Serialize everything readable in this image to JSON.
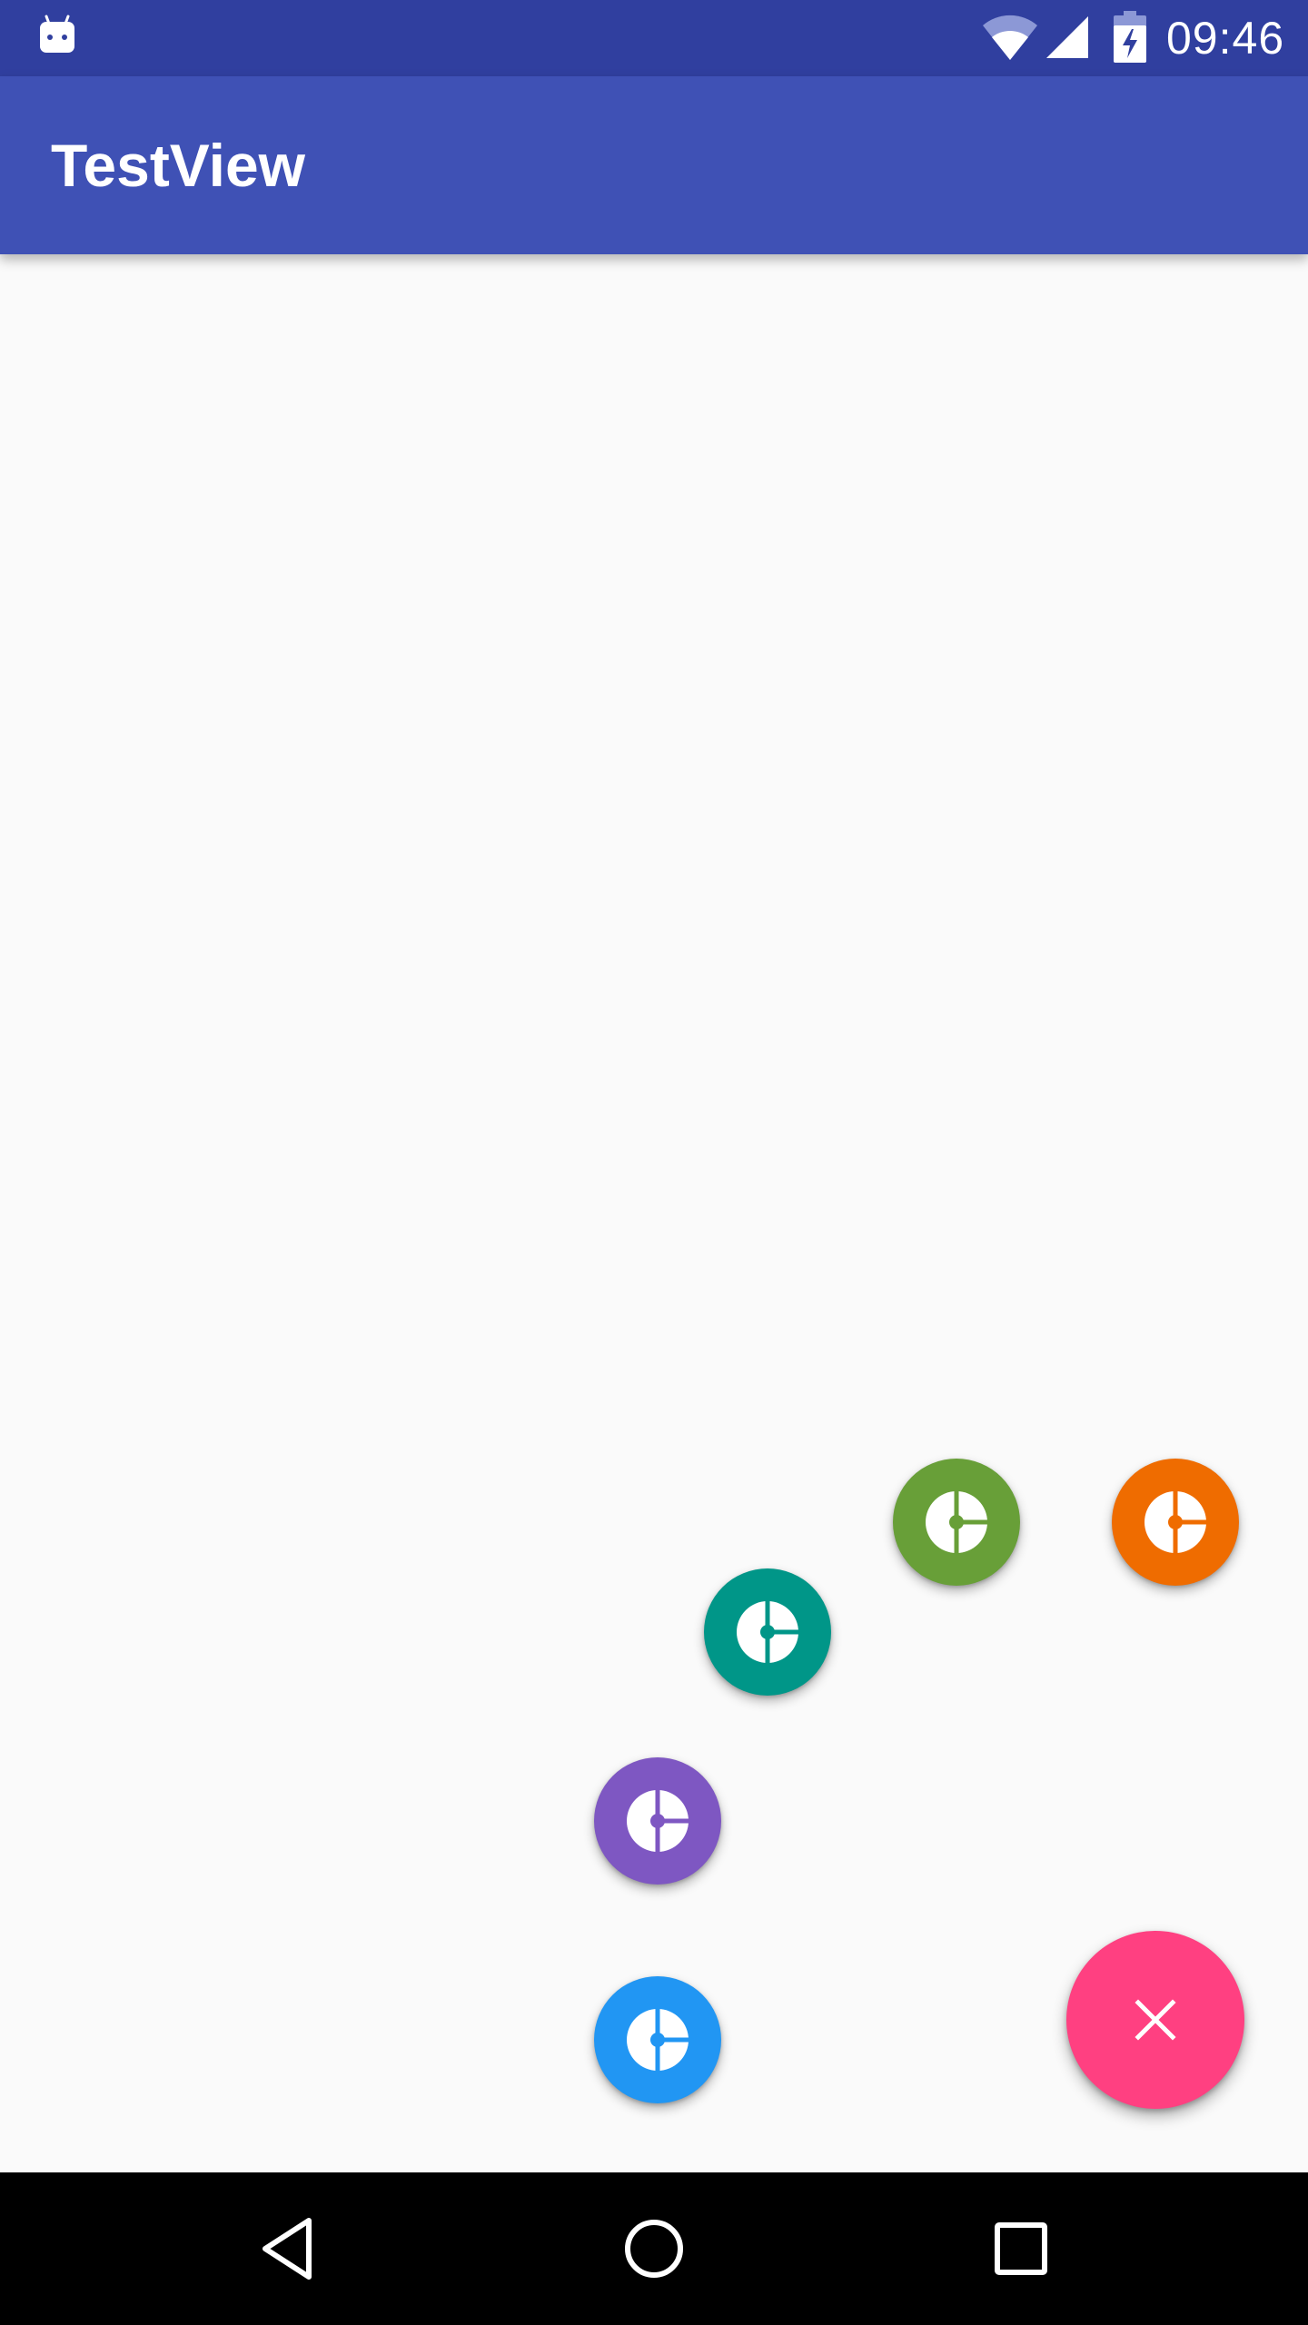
{
  "status_bar": {
    "time": "09:46",
    "icons": [
      "android-icon",
      "wifi-icon",
      "signal-icon",
      "battery-charging-icon"
    ]
  },
  "toolbar": {
    "title": "TestView"
  },
  "floating_menu": {
    "main_fab": {
      "icon": "close-icon",
      "color": "#ff4081"
    },
    "items": [
      {
        "name": "fab-green",
        "icon": "pie-chart-icon",
        "color": "#689f38"
      },
      {
        "name": "fab-orange",
        "icon": "pie-chart-icon",
        "color": "#ef6c00"
      },
      {
        "name": "fab-teal",
        "icon": "pie-chart-icon",
        "color": "#009688"
      },
      {
        "name": "fab-purple",
        "icon": "pie-chart-icon",
        "color": "#7e57c2"
      },
      {
        "name": "fab-blue",
        "icon": "pie-chart-icon",
        "color": "#2196f3"
      }
    ]
  },
  "nav_bar": {
    "buttons": [
      "back-icon",
      "home-icon",
      "recents-icon"
    ]
  },
  "colors": {
    "status_bar": "#303f9f",
    "toolbar": "#3f51b5",
    "background": "#fafafa"
  }
}
